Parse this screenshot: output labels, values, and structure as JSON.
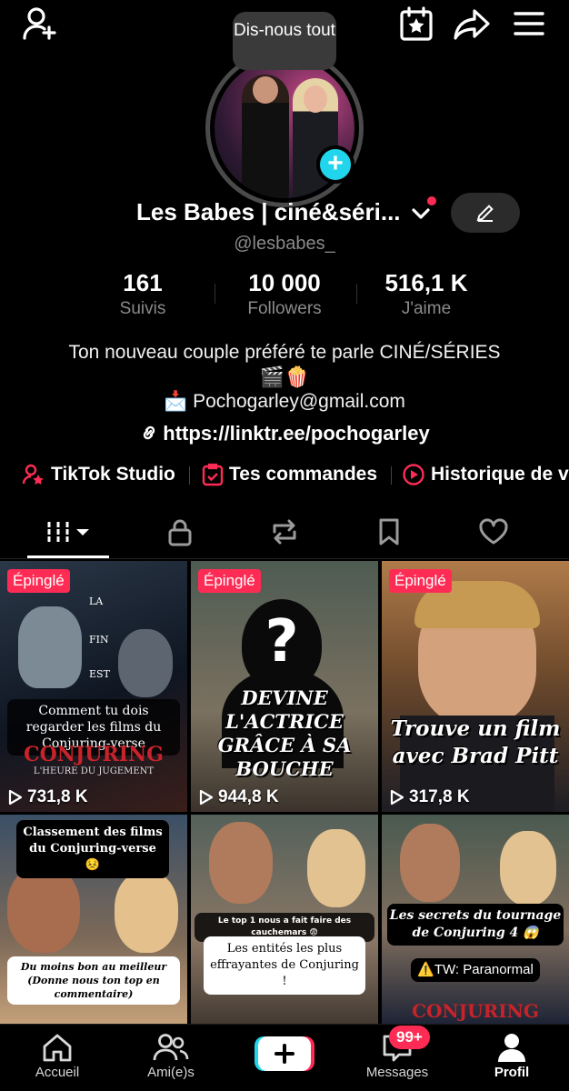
{
  "tooltip": "Dis-nous tout",
  "profile": {
    "name": "Les Babes | ciné&séri...",
    "handle": "@lesbabes_",
    "stats": [
      {
        "value": "161",
        "label": "Suivis"
      },
      {
        "value": "10 000",
        "label": "Followers"
      },
      {
        "value": "516,1 K",
        "label": "J'aime"
      }
    ],
    "bio_line1": "Ton nouveau couple préféré te parle CINÉ/SÉRIES",
    "bio_emoji": "🎬🍿",
    "email": "Pochogarley@gmail.com",
    "email_emoji": "📩",
    "link": "https://linktr.ee/pochogarley"
  },
  "quick_actions": [
    "TikTok Studio",
    "Tes commandes",
    "Historique de v"
  ],
  "tabs": [
    "videos",
    "private",
    "reposts",
    "favorites",
    "liked"
  ],
  "videos": [
    {
      "pinned": "Épinglé",
      "views": "731,8 K",
      "caption": "Comment tu dois regarder les films du Conjuring-verse",
      "overlay_title": "CONJURING",
      "overlay_sub": "L'HEURE DU JUGEMENT",
      "poster_words": [
        "LA",
        "FIN",
        "EST"
      ]
    },
    {
      "pinned": "Épinglé",
      "views": "944,8 K",
      "caption": "DEVINE L'ACTRICE GRÂCE À SA BOUCHE",
      "mark": "?"
    },
    {
      "pinned": "Épinglé",
      "views": "317,8 K",
      "caption": "Trouve un film avec Brad Pitt"
    },
    {
      "caption": "Classement des films du Conjuring-verse 😣",
      "caption2": "Du moins bon au meilleur (Donne nous ton top en commentaire)"
    },
    {
      "caption": "Le top 1 nous a fait faire des cauchemars 😨",
      "caption2": "Les entités les plus effrayantes de Conjuring !"
    },
    {
      "caption": "Les secrets du tournage de Conjuring 4 😱",
      "caption2": "⚠️TW: Paranormal",
      "overlay_title": "CONJURING"
    }
  ],
  "bottom_nav": [
    {
      "label": "Accueil"
    },
    {
      "label": "Ami(e)s"
    },
    {
      "label": "Messages",
      "badge": "99+"
    },
    {
      "label": "Profil"
    }
  ],
  "colors": {
    "accent": "#fe2c55",
    "cyan": "#20d5ec",
    "muted": "#8a8a8a"
  }
}
